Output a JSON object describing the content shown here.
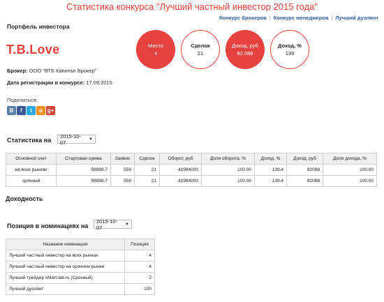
{
  "page_title": "Статистика конкурса \"Лучший частный инвестор 2015 года\"",
  "top_links": {
    "brokers": "Конкурс брокеров",
    "managers": "Конкурс менеджеров",
    "duplicate": "Лучший дуэлянт",
    "separator": "|"
  },
  "portfolio_heading": "Портфель инвестора",
  "investor_name": "T.B.Love",
  "stats_circles": [
    {
      "label": "Место",
      "value": "4"
    },
    {
      "label": "Сделок",
      "value": "21"
    },
    {
      "label": "Доход, руб",
      "value": "82 088"
    },
    {
      "label": "Доход, %",
      "value": "139"
    }
  ],
  "broker": {
    "label": "Брокер:",
    "value": "ООО \"ВТБ Капитал Брокер\""
  },
  "registration": {
    "label": "Дата регистрации в конкурсе:",
    "value": "17.09.2015"
  },
  "share": {
    "label": "Поделиться:",
    "icons": [
      {
        "name": "vk-icon",
        "glyph": "В",
        "color": "#5a7fa6"
      },
      {
        "name": "facebook-icon",
        "glyph": "f",
        "color": "#3b5998"
      },
      {
        "name": "twitter-icon",
        "glyph": "t",
        "color": "#2ca8e0"
      },
      {
        "name": "odnoklassniki-icon",
        "glyph": "o",
        "color": "#f39222"
      },
      {
        "name": "google-plus-icon",
        "glyph": "g+",
        "color": "#d34836"
      }
    ]
  },
  "stats_section": {
    "heading": "Статистика на",
    "date": "2015-10-07",
    "columns": [
      "Основной счет",
      "Стартовая сумма",
      "Заявок",
      "Сделок",
      "Оборот, руб",
      "Доля оборота, %",
      "Доход, %",
      "Доход, руб",
      "Доля дохода, %"
    ],
    "rows": [
      [
        "на всех рынках",
        "58888.7",
        "559",
        "21",
        "41984000",
        "100.00",
        "139.4",
        "82088",
        "100.00"
      ],
      [
        "срочный",
        "58888.7",
        "559",
        "21",
        "41984000",
        "100.00",
        "139.4",
        "82088",
        "100.00"
      ]
    ]
  },
  "yield_heading": "Доходность",
  "nominations_section": {
    "heading": "Позиция в номинациях на",
    "date": "2015-10-07",
    "columns": [
      "Название номинации",
      "Позиция"
    ],
    "rows": [
      [
        "Лучший частный инвестор на всех рынках",
        "4"
      ],
      [
        "Лучший частный инвестор на срочном рынке",
        "4"
      ],
      [
        "Лучший трейдер sMart-lab.ru (Срочный)",
        "2"
      ],
      [
        "Лучший дуэлянт",
        "100"
      ]
    ]
  },
  "colors": {
    "accent": "#e8423f",
    "link": "#2f5e97"
  }
}
